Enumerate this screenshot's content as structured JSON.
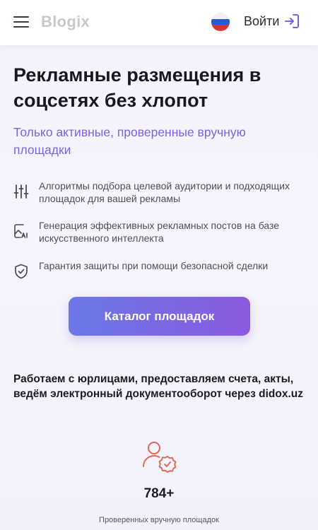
{
  "header": {
    "logo": "Blogix",
    "login_label": "Войти",
    "language_flag": "ru-flag-icon"
  },
  "hero": {
    "title": "Рекламные размещения в соцсетях без хлопот",
    "subtitle": "Только активные, проверенные вручную площадки"
  },
  "features": [
    {
      "icon": "sliders-icon",
      "text": "Алгоритмы подбора целевой аудитории и подходящих площадок для вашей рекламы"
    },
    {
      "icon": "ai-image-icon",
      "text": "Генерация эффективных рекламных постов на базе искусственного интеллекта"
    },
    {
      "icon": "shield-check-icon",
      "text": "Гарантия защиты при помощи безопасной сделки"
    }
  ],
  "cta": {
    "label": "Каталог площадок"
  },
  "legal_note": "Работаем с юрлицами, предоставляем счета, акты, ведём электронный документооборот через didox.uz",
  "stats": [
    {
      "icon": "verified-user-icon",
      "value": "784+",
      "label": "Проверенных вручную площадок"
    }
  ],
  "colors": {
    "accent": "#7b62e0",
    "cta_gradient_start": "#6b78e6",
    "cta_gradient_end": "#8a5ae0",
    "stat_icon": "#e06a5a"
  }
}
